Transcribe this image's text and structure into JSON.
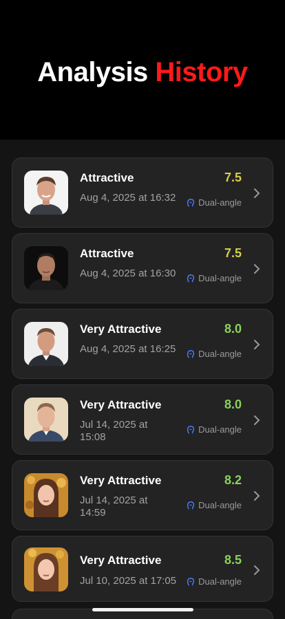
{
  "header": {
    "title_part1": "Analysis",
    "title_part2": "History"
  },
  "colors": {
    "accent_red": "#ff1a1a",
    "score_yellow": "#d4cf4a",
    "score_green": "#8bd25a",
    "mode_icon_blue": "#4a7bff"
  },
  "history": [
    {
      "label": "Attractive",
      "date": "Aug 4, 2025 at 16:32",
      "score": "7.5",
      "mode": "Dual-angle",
      "icon": "chevron-right-icon"
    },
    {
      "label": "Attractive",
      "date": "Aug 4, 2025 at 16:30",
      "score": "7.5",
      "mode": "Dual-angle",
      "icon": "chevron-right-icon"
    },
    {
      "label": "Very Attractive",
      "date": "Aug 4, 2025 at 16:25",
      "score": "8.0",
      "mode": "Dual-angle",
      "icon": "chevron-right-icon"
    },
    {
      "label": "Very Attractive",
      "date": "Jul 14, 2025 at 15:08",
      "score": "8.0",
      "mode": "Dual-angle",
      "icon": "chevron-right-icon"
    },
    {
      "label": "Very Attractive",
      "date": "Jul 14, 2025 at 14:59",
      "score": "8.2",
      "mode": "Dual-angle",
      "icon": "chevron-right-icon"
    },
    {
      "label": "Very Attractive",
      "date": "Jul 10, 2025 at 17:05",
      "score": "8.5",
      "mode": "Dual-angle",
      "icon": "chevron-right-icon"
    }
  ]
}
